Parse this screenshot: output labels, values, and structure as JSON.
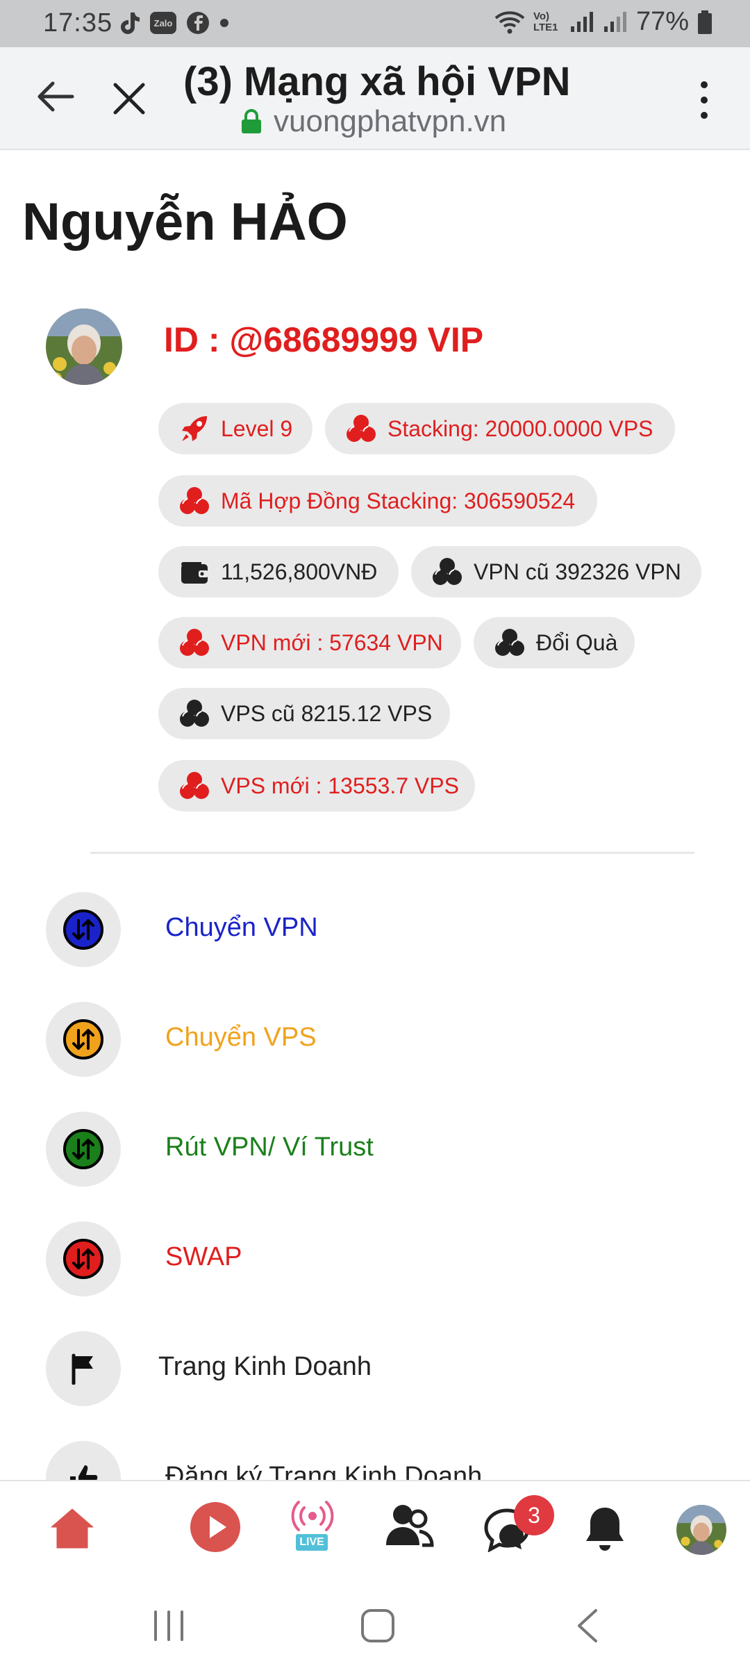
{
  "status_bar": {
    "time": "17:35",
    "zalo_label": "Zalo",
    "network_label": "Vo) LTE1",
    "battery": "77%"
  },
  "browser": {
    "title": "(3) Mạng xã hội VPN",
    "url": "vuongphatvpn.vn"
  },
  "profile": {
    "name": "Nguyễn HẢO",
    "id_line": "ID : @68689999 VIP",
    "pills": {
      "level": "Level 9",
      "stacking": "Stacking: 20000.0000 VPS",
      "contract": "Mã Hợp Đồng Stacking: 306590524",
      "wallet": "11,526,800VNĐ",
      "vpn_old": "VPN cũ 392326 VPN",
      "vpn_new": "VPN mới : 57634 VPN",
      "gift": "Đổi Quà",
      "vps_old": "VPS cũ 8215.12 VPS",
      "vps_new": "VPS mới : 13553.7 VPS"
    }
  },
  "menu": {
    "transfer_vpn": "Chuyển VPN",
    "transfer_vps": "Chuyển VPS",
    "withdraw": "Rút VPN/ Ví Trust",
    "swap": "SWAP",
    "business_page": "Trang Kinh Doanh",
    "register_business": "Đăng ký Trang Kinh Doanh"
  },
  "bottom_nav": {
    "live_label": "LIVE",
    "messages_badge": "3"
  },
  "colors": {
    "red": "#e01e1e",
    "blue": "#1a23c9",
    "orange": "#f0a21c",
    "green": "#1b7f1b",
    "home": "#d9534f"
  }
}
